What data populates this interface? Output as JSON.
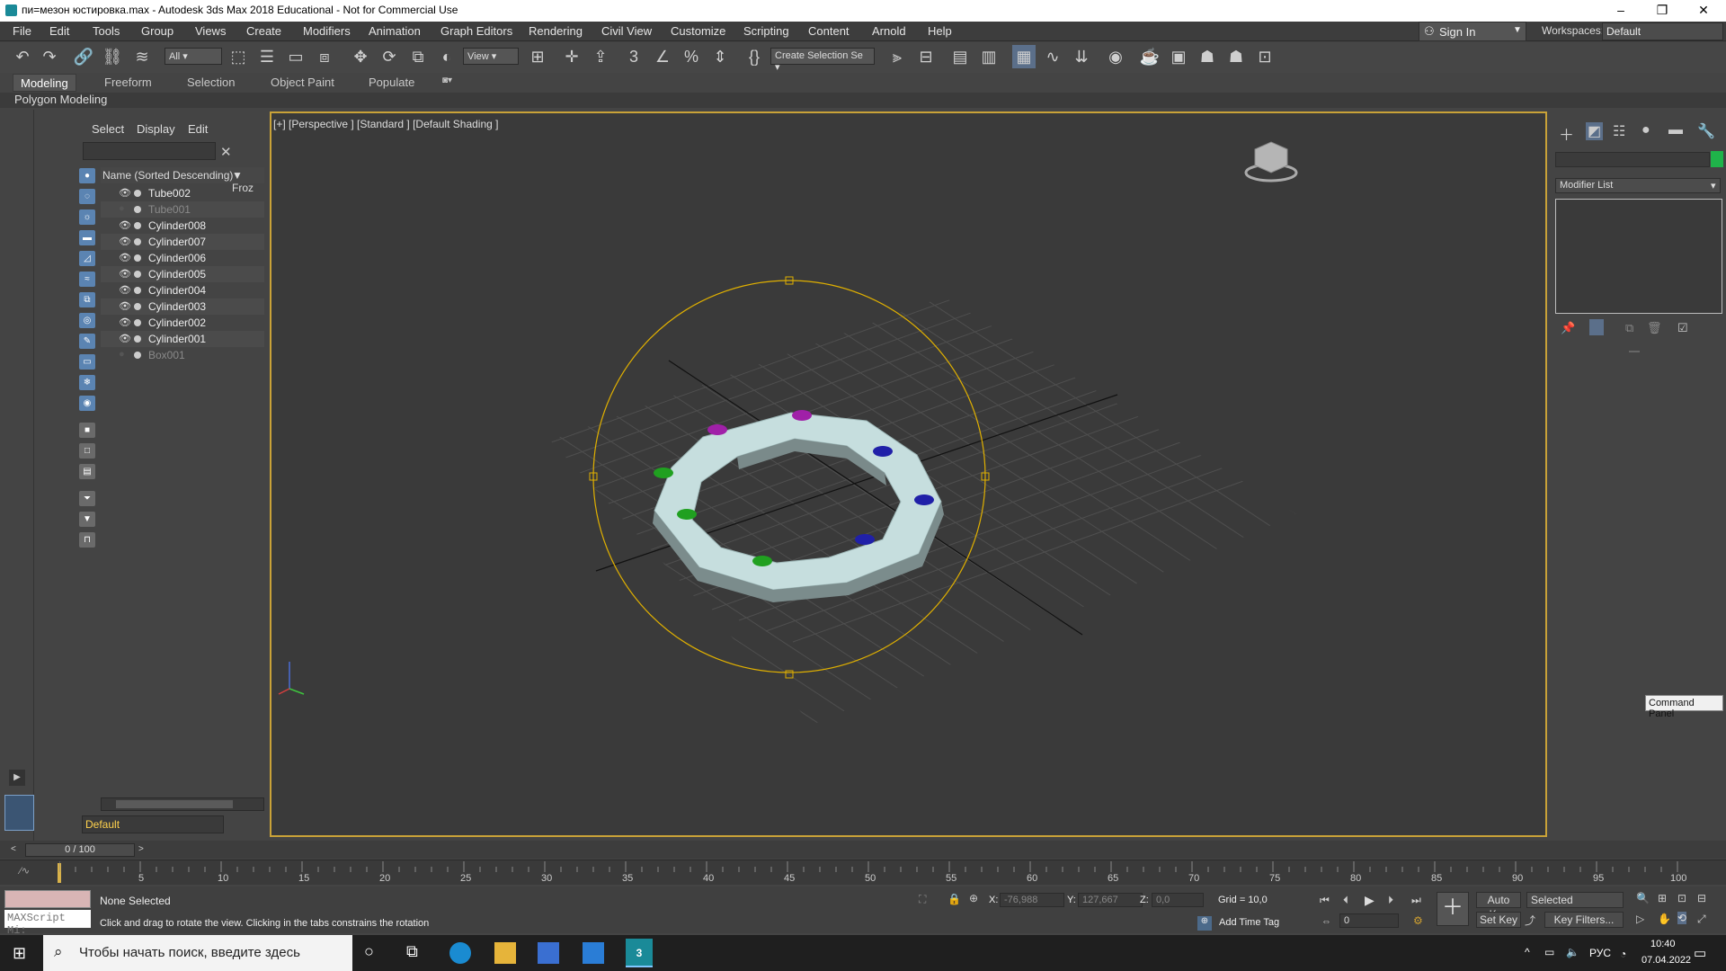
{
  "window": {
    "title": "пи=мезон юстировка.max - Autodesk 3ds Max 2018 Educational - Not for Commercial Use",
    "minimize": "–",
    "restore": "❐",
    "close": "✕"
  },
  "menu": [
    "File",
    "Edit",
    "Tools",
    "Group",
    "Views",
    "Create",
    "Modifiers",
    "Animation",
    "Graph Editors",
    "Rendering",
    "Civil View",
    "Customize",
    "Scripting",
    "Content",
    "Arnold",
    "Help"
  ],
  "account": {
    "sign_in": "Sign In",
    "workspaces_label": "Workspaces:",
    "workspace": "Default"
  },
  "toolbar": {
    "filter": "All",
    "ref_coord": "View",
    "selection_set": "Create Selection Se"
  },
  "ribbon": {
    "tabs": [
      "Modeling",
      "Freeform",
      "Selection",
      "Object Paint",
      "Populate"
    ],
    "active": "Modeling",
    "panel": "Polygon Modeling"
  },
  "explorer": {
    "tabs": [
      "Select",
      "Display",
      "Edit"
    ],
    "header_name": "Name (Sorted Descending)",
    "header_frozen": "Froz",
    "items": [
      {
        "name": "Tube002",
        "visible": true
      },
      {
        "name": "Tube001",
        "visible": false
      },
      {
        "name": "Cylinder008",
        "visible": true
      },
      {
        "name": "Cylinder007",
        "visible": true
      },
      {
        "name": "Cylinder006",
        "visible": true
      },
      {
        "name": "Cylinder005",
        "visible": true
      },
      {
        "name": "Cylinder004",
        "visible": true
      },
      {
        "name": "Cylinder003",
        "visible": true
      },
      {
        "name": "Cylinder002",
        "visible": true
      },
      {
        "name": "Cylinder001",
        "visible": true
      },
      {
        "name": "Box001",
        "visible": false
      }
    ],
    "layer": "Default"
  },
  "viewport": {
    "label": "[+] [Perspective ] [Standard ] [Default Shading ]"
  },
  "command_panel": {
    "modifier_list": "Modifier List",
    "tooltip": "Command Panel",
    "object_color": "#1fb34a"
  },
  "timeline": {
    "frame": "0 / 100",
    "ticks": [
      "5",
      "10",
      "15",
      "20",
      "25",
      "30",
      "35",
      "40",
      "45",
      "50",
      "55",
      "60",
      "65",
      "70",
      "75",
      "80",
      "85",
      "90",
      "95",
      "100"
    ]
  },
  "status": {
    "selection": "None Selected",
    "prompt": "Click and drag to rotate the view.  Clicking in the tabs constrains the rotation",
    "x_label": "X:",
    "x": "-76,988",
    "y_label": "Y:",
    "y": "127,667",
    "z_label": "Z:",
    "z": "0,0",
    "grid": "Grid = 10,0",
    "add_time_tag": "Add Time Tag",
    "auto_key": "Auto Key",
    "set_key": "Set Key",
    "key_mode": "Selected",
    "key_filters": "Key Filters...",
    "current_frame": "0",
    "maxscript": "MAXScript Mi:"
  },
  "taskbar": {
    "search_placeholder": "Чтобы начать поиск, введите здесь",
    "lang": "РУС",
    "time": "10:40",
    "date": "07.04.2022"
  },
  "colors": {
    "accent": "#c9a238",
    "tube": "#cfe6e6"
  }
}
